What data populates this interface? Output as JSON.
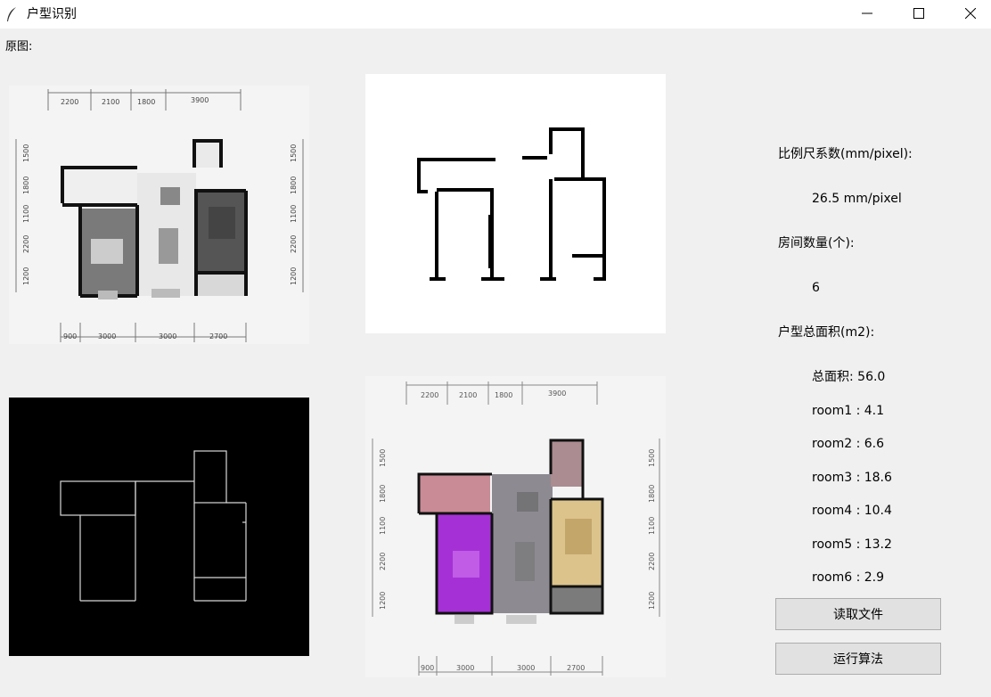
{
  "window": {
    "title": "户型识别",
    "controls": {
      "minimize": "minimize-icon",
      "maximize": "maximize-icon",
      "close": "close-icon"
    }
  },
  "labels": {
    "original": "原图:"
  },
  "plan": {
    "top_dims": [
      "2200",
      "2100",
      "1800",
      "3900"
    ],
    "bottom_dims": [
      "900",
      "3000",
      "3000",
      "2700"
    ],
    "side_dims": [
      "1500",
      "1800",
      "1100",
      "2200",
      "1200"
    ]
  },
  "info": {
    "scale_label": "比例尺系数(mm/pixel):",
    "scale_value": "26.5  mm/pixel",
    "room_count_label": "房间数量(个):",
    "room_count_value": "6",
    "area_label": "户型总面积(m2):",
    "total_area": "总面积: 56.0",
    "rooms": [
      "room1 : 4.1",
      "room2 : 6.6",
      "room3 : 18.6",
      "room4 : 10.4",
      "room5 : 13.2",
      "room6 : 2.9"
    ]
  },
  "buttons": {
    "read_file": "读取文件",
    "run_algorithm": "运行算法"
  },
  "colors": {
    "room_pink": "#c98b96",
    "room_purple": "#a531d6",
    "room_gray": "#8e8a92",
    "room_tan": "#dcc38c",
    "room_mauve": "#ab8c90",
    "room_dark": "#7b7b7b"
  }
}
